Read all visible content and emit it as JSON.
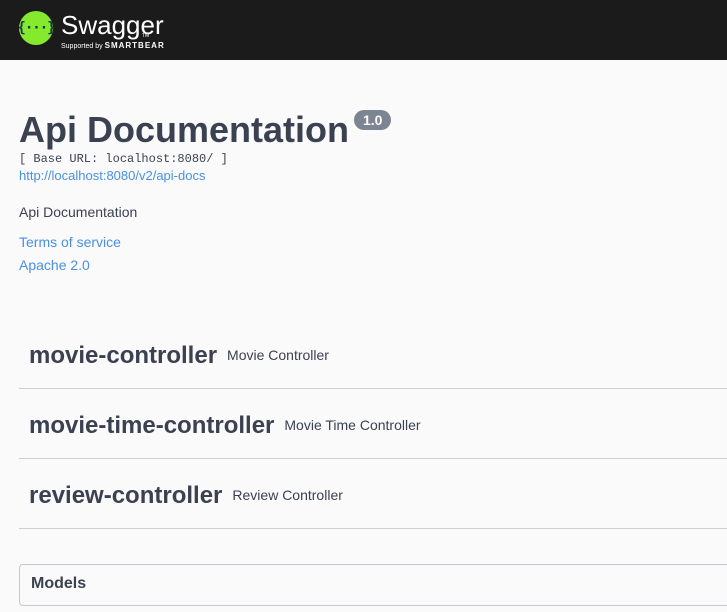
{
  "topbar": {
    "logo_glyph": "{···}",
    "brand_name": "Swagger",
    "brand_tm": "TM",
    "brand_sub_prefix": "Supported by",
    "brand_sub_company": "SMARTBEAR",
    "background": "#1b1b1b",
    "logo_color": "#85ea2d"
  },
  "info": {
    "title": "Api Documentation",
    "version": "1.0",
    "base_url": "[ Base URL: localhost:8080/ ]",
    "docs_url": "http://localhost:8080/v2/api-docs",
    "description": "Api Documentation",
    "terms_of_service": "Terms of service",
    "license": "Apache 2.0",
    "link_color": "#4990e2"
  },
  "tags": [
    {
      "name": "movie-controller",
      "description": "Movie Controller"
    },
    {
      "name": "movie-time-controller",
      "description": "Movie Time Controller"
    },
    {
      "name": "review-controller",
      "description": "Review Controller"
    }
  ],
  "models": {
    "label": "Models"
  },
  "icons": {
    "logo": "swagger-logo-icon"
  }
}
